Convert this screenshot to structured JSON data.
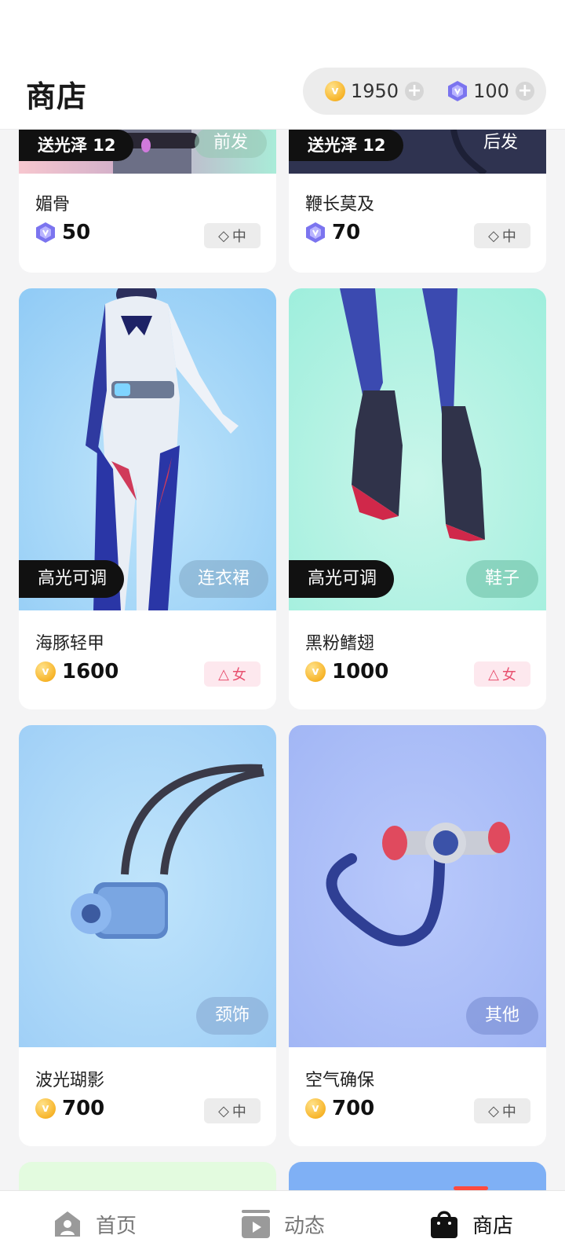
{
  "header": {
    "title": "商店",
    "wallet": {
      "coins": "1950",
      "gems": "100"
    }
  },
  "top_items": [
    {
      "left_tag": "送光泽 12",
      "right_tag": "前发",
      "name": "媚骨",
      "currency": "gem",
      "price": "50",
      "tag": "中"
    },
    {
      "left_tag": "送光泽 12",
      "right_tag": "后发",
      "name": "鞭长莫及",
      "currency": "gem",
      "price": "70",
      "tag": "中"
    }
  ],
  "items": [
    {
      "left_tag": "高光可调",
      "right_tag": "连衣裙",
      "name": "海豚轻甲",
      "currency": "coin",
      "price": "1600",
      "tag": "女"
    },
    {
      "left_tag": "高光可调",
      "right_tag": "鞋子",
      "name": "黑粉鳍翅",
      "currency": "coin",
      "price": "1000",
      "tag": "女"
    },
    {
      "right_tag": "颈饰",
      "name": "波光瑚影",
      "currency": "coin",
      "price": "700",
      "tag": "中"
    },
    {
      "right_tag": "其他",
      "name": "空气确保",
      "currency": "coin",
      "price": "700",
      "tag": "中"
    }
  ],
  "nav": {
    "home": "首页",
    "feed": "动态",
    "shop": "商店"
  },
  "colors": {
    "coin": "#f7b52b",
    "gem": "#7b74ef",
    "active_indicator": "#ff4b3e"
  }
}
